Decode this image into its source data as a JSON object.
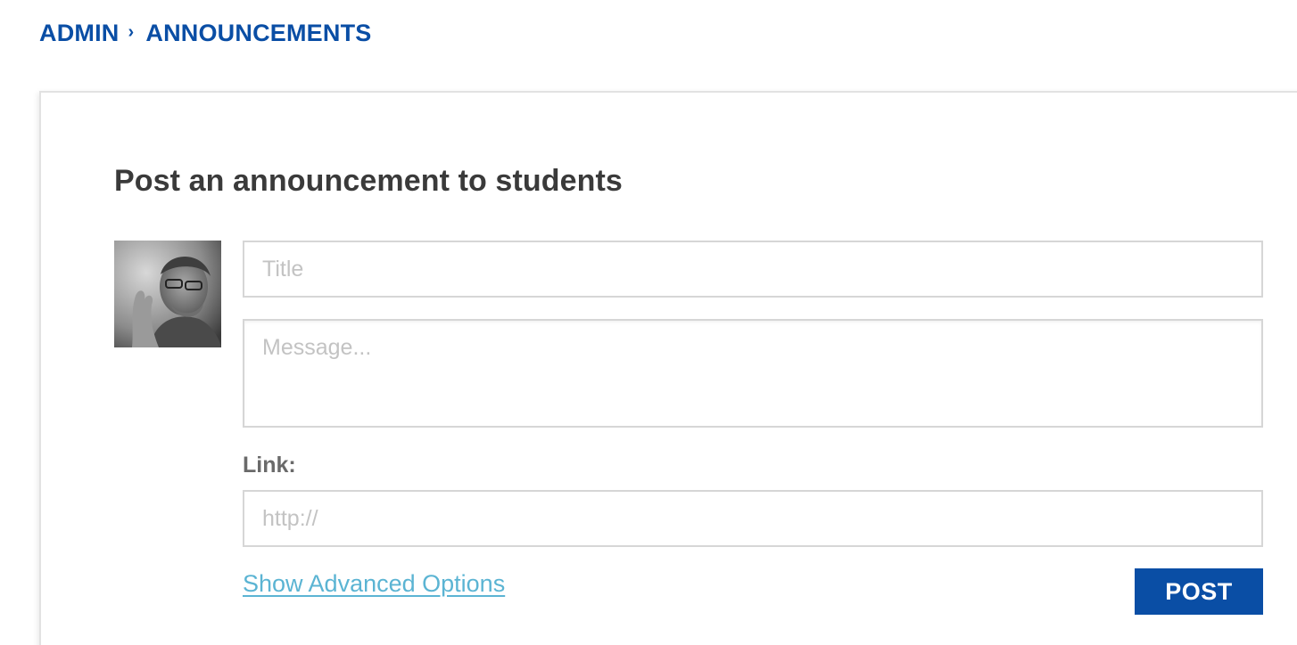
{
  "breadcrumb": {
    "items": [
      {
        "label": "ADMIN"
      },
      {
        "label": "ANNOUNCEMENTS"
      }
    ],
    "separator": "›"
  },
  "form": {
    "heading": "Post an announcement to students",
    "title_input": {
      "value": "",
      "placeholder": "Title"
    },
    "message_input": {
      "value": "",
      "placeholder": "Message..."
    },
    "link_label": "Link:",
    "link_input": {
      "value": "",
      "placeholder": "http://"
    },
    "advanced_options_label": "Show Advanced Options",
    "post_button_label": "POST"
  },
  "colors": {
    "brand": "#0a4ea5",
    "link": "#5bb4d3",
    "heading": "#3a3a3a",
    "border": "#d6d6d6"
  }
}
